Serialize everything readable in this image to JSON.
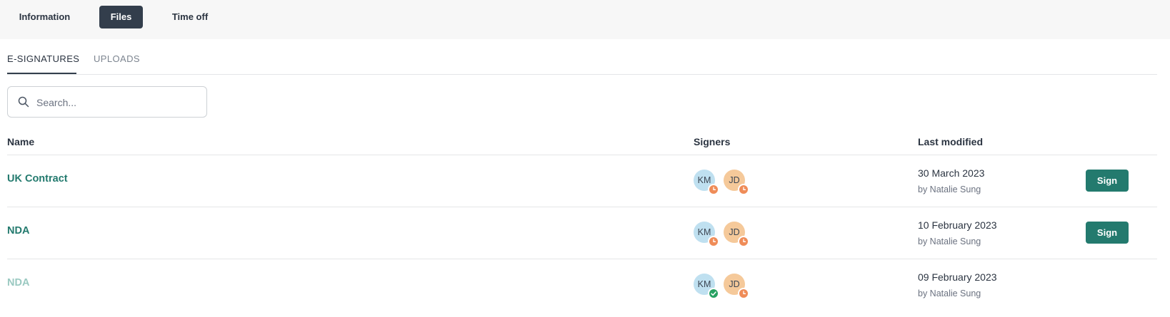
{
  "top_tabs": [
    {
      "label": "Information",
      "active": false
    },
    {
      "label": "Files",
      "active": true
    },
    {
      "label": "Time off",
      "active": false
    }
  ],
  "sub_tabs": [
    {
      "label": "E-SIGNATURES",
      "active": true
    },
    {
      "label": "UPLOADS",
      "active": false
    }
  ],
  "search": {
    "placeholder": "Search...",
    "value": "",
    "icon": "search-icon"
  },
  "table": {
    "headers": {
      "name": "Name",
      "signers": "Signers",
      "modified": "Last modified"
    },
    "rows": [
      {
        "name": "UK Contract",
        "muted": false,
        "signers": [
          {
            "initials": "KM",
            "status": "pending"
          },
          {
            "initials": "JD",
            "status": "pending"
          }
        ],
        "date": "30 March 2023",
        "by": "by Natalie Sung",
        "action": "Sign"
      },
      {
        "name": "NDA",
        "muted": false,
        "signers": [
          {
            "initials": "KM",
            "status": "pending"
          },
          {
            "initials": "JD",
            "status": "pending"
          }
        ],
        "date": "10 February 2023",
        "by": "by Natalie Sung",
        "action": "Sign"
      },
      {
        "name": "NDA",
        "muted": true,
        "signers": [
          {
            "initials": "KM",
            "status": "signed"
          },
          {
            "initials": "JD",
            "status": "pending"
          }
        ],
        "date": "09 February 2023",
        "by": "by Natalie Sung",
        "action": ""
      }
    ]
  },
  "colors": {
    "accent": "#237a6e",
    "active_tab": "#333e4c",
    "pending": "#ef8c58",
    "signed": "#27a162",
    "avatar_km": "#bfe0f0",
    "avatar_jd": "#f5c99a"
  }
}
